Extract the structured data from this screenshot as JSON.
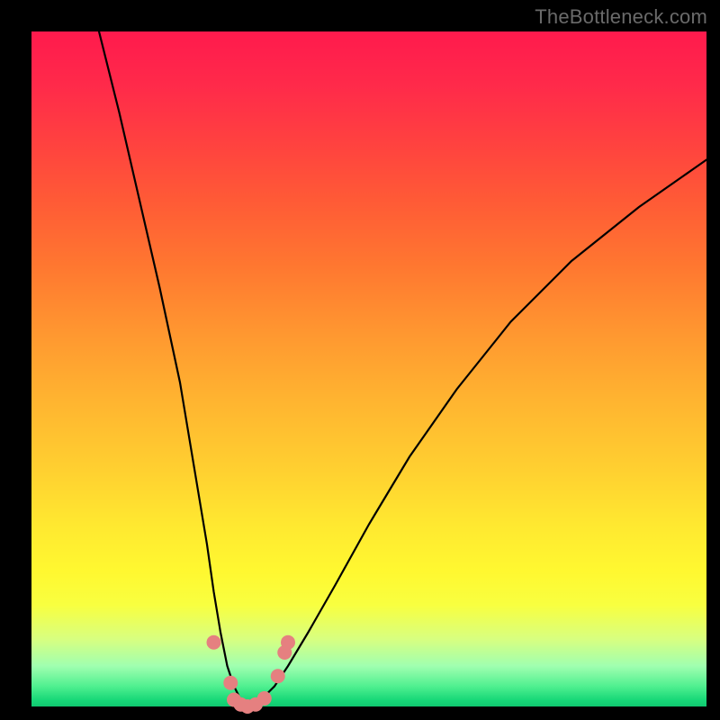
{
  "watermark": "TheBottleneck.com",
  "colors": {
    "frame": "#000000",
    "curve": "#000000",
    "marker": "#e58080",
    "gradient_top": "#ff1a4d",
    "gradient_bottom": "#10c870"
  },
  "chart_data": {
    "type": "line",
    "title": "",
    "xlabel": "",
    "ylabel": "",
    "xlim": [
      0,
      100
    ],
    "ylim": [
      0,
      100
    ],
    "grid": false,
    "note": "V-shaped bottleneck curve; y-axis inverted visually (low values at bottom = green/good). Values estimated from curve shape as percentage of plot area.",
    "series": [
      {
        "name": "left-branch",
        "x": [
          10,
          13,
          16,
          19,
          22,
          24,
          26,
          27,
          28,
          29,
          30,
          31,
          32
        ],
        "y": [
          100,
          88,
          75,
          62,
          48,
          36,
          24,
          17,
          11,
          6,
          3,
          1,
          0
        ]
      },
      {
        "name": "right-branch",
        "x": [
          32,
          34,
          36,
          38,
          41,
          45,
          50,
          56,
          63,
          71,
          80,
          90,
          100
        ],
        "y": [
          0,
          1,
          3,
          6,
          11,
          18,
          27,
          37,
          47,
          57,
          66,
          74,
          81
        ]
      }
    ],
    "markers": {
      "name": "highlighted-points",
      "note": "salmon dots near the minimum",
      "points": [
        {
          "x": 27.0,
          "y": 9.5
        },
        {
          "x": 29.5,
          "y": 3.5
        },
        {
          "x": 30.0,
          "y": 1.0
        },
        {
          "x": 31.0,
          "y": 0.3
        },
        {
          "x": 32.0,
          "y": 0.0
        },
        {
          "x": 33.2,
          "y": 0.3
        },
        {
          "x": 34.5,
          "y": 1.2
        },
        {
          "x": 36.5,
          "y": 4.5
        },
        {
          "x": 37.5,
          "y": 8.0
        },
        {
          "x": 38.0,
          "y": 9.5
        }
      ]
    }
  }
}
